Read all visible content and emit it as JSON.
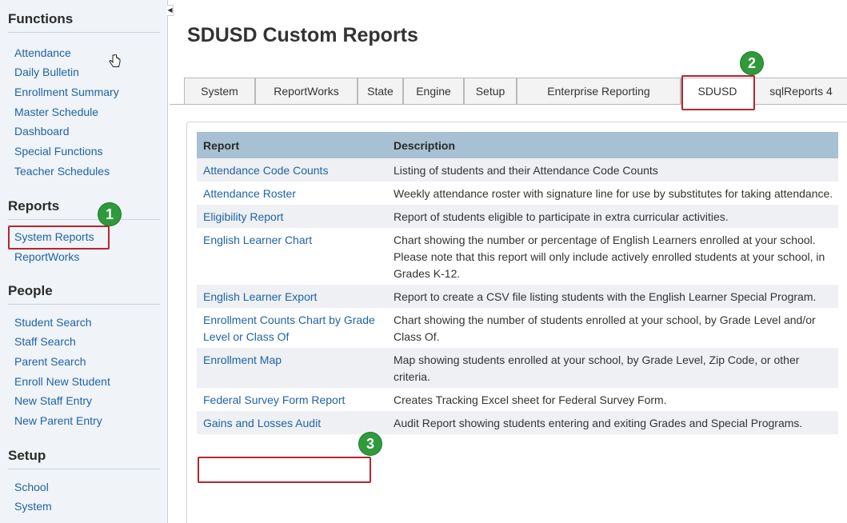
{
  "sidebar": {
    "sections": [
      {
        "title": "Functions",
        "items": [
          "Attendance",
          "Daily Bulletin",
          "Enrollment Summary",
          "Master Schedule",
          "Dashboard",
          "Special Functions",
          "Teacher Schedules"
        ]
      },
      {
        "title": "Reports",
        "items": [
          "System Reports",
          "ReportWorks"
        ]
      },
      {
        "title": "People",
        "items": [
          "Student Search",
          "Staff Search",
          "Parent Search",
          "Enroll New Student",
          "New Staff Entry",
          "New Parent Entry"
        ]
      },
      {
        "title": "Setup",
        "items": [
          "School",
          "System"
        ]
      }
    ]
  },
  "main": {
    "title": "SDUSD Custom Reports",
    "tabs": [
      "System",
      "ReportWorks",
      "State",
      "Engine",
      "Setup",
      "Enterprise Reporting",
      "SDUSD",
      "sqlReports 4"
    ],
    "active_tab": "SDUSD",
    "table": {
      "headers": [
        "Report",
        "Description"
      ],
      "rows": [
        {
          "report": "Attendance Code Counts",
          "description": "Listing of students and their Attendance Code Counts"
        },
        {
          "report": "Attendance Roster",
          "description": "Weekly attendance roster with signature line for use by substitutes for taking attendance."
        },
        {
          "report": "Eligibility Report",
          "description": "Report of students eligible to participate in extra curricular activities."
        },
        {
          "report": "English Learner Chart",
          "description": "Chart showing the number or percentage of English Learners enrolled at your school. Please note that this report will only include actively enrolled students at your school, in Grades K-12."
        },
        {
          "report": "English Learner Export",
          "description": "Report to create a CSV file listing students with the English Learner Special Program."
        },
        {
          "report": "Enrollment Counts Chart by Grade Level or Class Of",
          "description": "Chart showing the number of students enrolled at your school, by Grade Level and/or Class Of."
        },
        {
          "report": "Enrollment Map",
          "description": "Map showing students enrolled at your school, by Grade Level, Zip Code, or other criteria."
        },
        {
          "report": "Federal Survey Form Report",
          "description": "Creates Tracking Excel sheet for Federal Survey Form."
        },
        {
          "report": "Gains and Losses Audit",
          "description": "Audit Report showing students entering and exiting Grades and Special Programs."
        }
      ]
    }
  },
  "annotations": {
    "badge1": "1",
    "badge2": "2",
    "badge3": "3"
  },
  "icons": {
    "collapse": "collapse-arrow-icon",
    "cursor": "hand-pointer-icon"
  },
  "colors": {
    "link": "#1e63a8",
    "header_bg": "#a7c0d2",
    "highlight": "#b3272d",
    "badge": "#2f9a3c"
  }
}
